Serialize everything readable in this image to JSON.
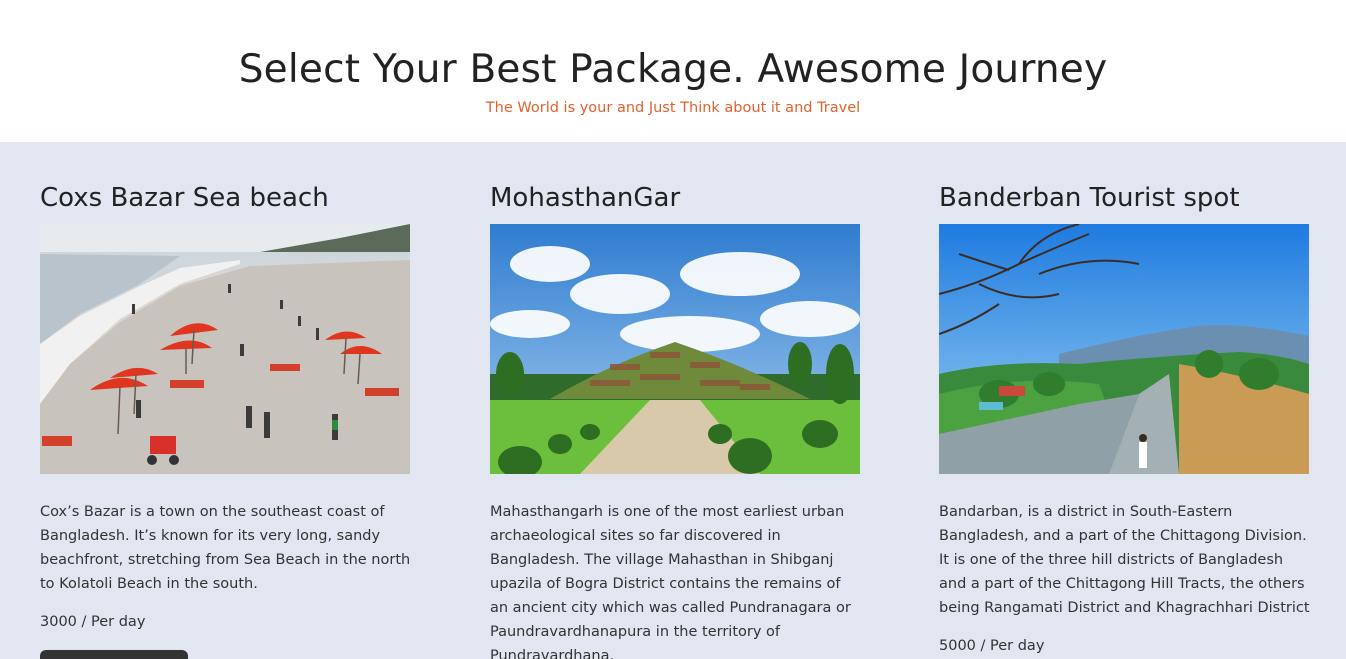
{
  "header": {
    "title": "Select Your Best Package. Awesome Journey",
    "subtitle": "The World is your and Just Think about it and Travel"
  },
  "packages": [
    {
      "title": "Coxs Bazar Sea beach",
      "image_alt": "Cox's Bazar beach with red umbrellas",
      "description": "Cox’s Bazar is a town on the southeast coast of Bangladesh. It’s known for its very long, sandy beachfront, stretching from Sea Beach in the north to Kolatoli Beach in the south.",
      "price": "3000 / Per day"
    },
    {
      "title": "MohasthanGar",
      "image_alt": "Mahasthangarh archaeological mound",
      "description": "Mahasthangarh is one of the most earliest urban archaeological sites so far discovered in Bangladesh. The village Mahasthan in Shibganj upazila of Bogra District contains the remains of an ancient city which was called Pundranagara or Paundravardhanapura in the territory of Pundravardhana.",
      "price": ""
    },
    {
      "title": "Banderban Tourist spot",
      "image_alt": "Bandarban hills and road",
      "description": "Bandarban, is a district in South-Eastern Bangladesh, and a part of the Chittagong Division. It is one of the three hill districts of Bangladesh and a part of the Chittagong Hill Tracts, the others being Rangamati District and Khagrachhari District",
      "price": "5000 / Per day"
    }
  ]
}
